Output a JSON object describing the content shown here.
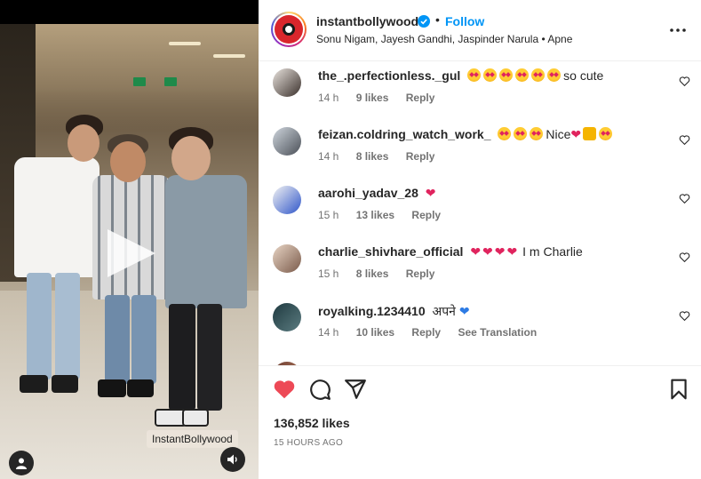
{
  "post": {
    "account": "instantbollywood",
    "follow_label": "Follow",
    "separator": "•",
    "audio": "Sonu Nigam, Jayesh Gandhi, Jaspinder Narula • Apne",
    "watermark": "InstantBollywood",
    "likes": "136,852 likes",
    "time": "15 HOURS AGO"
  },
  "comments": [
    {
      "user": "the_.perfectionless._gul",
      "emojis": 6,
      "text": "so cute",
      "age": "14 h",
      "likes": "9 likes",
      "reply": "Reply"
    },
    {
      "user": "feizan.coldring_watch_work_",
      "emojis": 3,
      "text": "Nice",
      "age": "14 h",
      "likes": "8 likes",
      "reply": "Reply"
    },
    {
      "user": "aarohi_yadav_28",
      "age": "15 h",
      "likes": "13 likes",
      "reply": "Reply"
    },
    {
      "user": "charlie_shivhare_official",
      "text": "I m Charlie",
      "age": "15 h",
      "likes": "8 likes",
      "reply": "Reply"
    },
    {
      "user": "royalking.1234410",
      "text": "अपने",
      "age": "14 h",
      "likes": "10 likes",
      "reply": "Reply",
      "translation": "See Translation"
    }
  ],
  "icons": {
    "more": "more-options-icon",
    "like": "heart-filled-icon",
    "comment": "comment-icon",
    "share": "share-icon",
    "save": "bookmark-icon",
    "mute": "sound-icon",
    "tags": "user-tag-icon"
  },
  "colors": {
    "accent": "#0095f6",
    "heart": "#ed4956",
    "text": "#262626",
    "muted": "#737373"
  }
}
